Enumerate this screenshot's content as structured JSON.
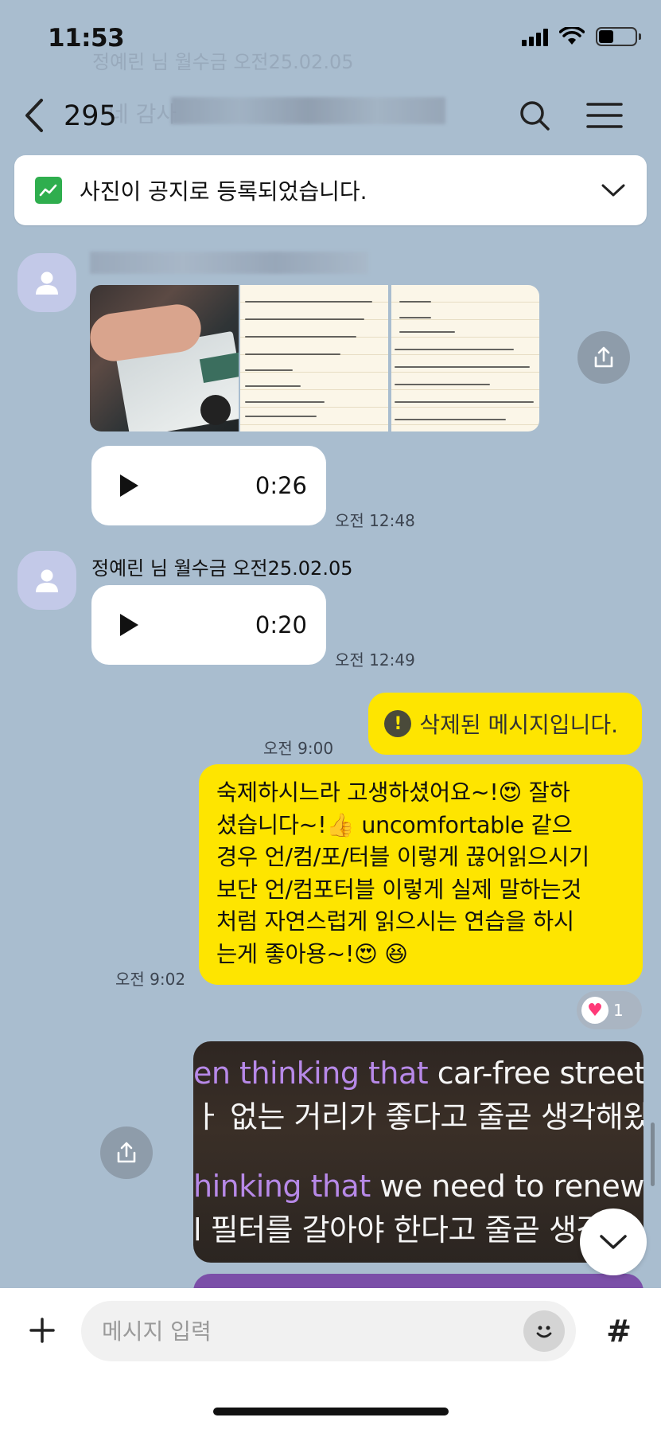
{
  "status_bar": {
    "time": "11:53",
    "battery_level": 0.4
  },
  "ghost_text": {
    "sender_line": "정예린 님 월수금 오전25.02.05",
    "message": "네 감사"
  },
  "header": {
    "member_count": "295"
  },
  "notice": {
    "text": "사진이 공지로 등록되었습니다."
  },
  "messages": {
    "voice1": {
      "duration": "0:26",
      "time": "오전 12:48"
    },
    "sender2": "정예린 님 월수금 오전25.02.05",
    "voice2": {
      "duration": "0:20",
      "time": "오전 12:49"
    },
    "deleted": {
      "text": "삭제된 메시지입니다.",
      "time": "오전 9:00"
    },
    "long": {
      "lines": [
        "숙제하시느라 고생하셨어요~!😍 잘하",
        "셨습니다~!👍 uncomfortable 같으",
        "경우 언/컴/포/터블 이렇게 끊어읽으시기",
        "보단 언/컴포터블 이렇게 실제 말하는것",
        "처럼 자연스럽게 읽으시는 연습을 하시",
        "는게 좋아용~!😍 😆"
      ],
      "time": "오전 9:02",
      "reaction_count": "1"
    },
    "video": {
      "line1_purple": "en thinking that",
      "line1_white": " car-free streets a",
      "line2": "ㅏ 없는 거리가 좋다고 줄곧 생각해왔어",
      "line3_purple": "hinking that",
      "line3_white": " we need to renew th",
      "line4": "l 필터를 갈아야 한다고 줄곧 생각"
    }
  },
  "composer": {
    "placeholder": "메시지 입력"
  },
  "icons": [
    "back-chevron-icon",
    "search-icon",
    "menu-icon",
    "chart-icon",
    "chevron-down-icon",
    "person-icon",
    "share-icon",
    "play-icon",
    "warning-icon",
    "heart-icon",
    "plus-icon",
    "emoji-icon",
    "hash-icon"
  ],
  "colors": {
    "background": "#a9bdcf",
    "my_bubble": "#fee500",
    "notice_icon": "#2fae4e",
    "heart": "#ff3a78"
  }
}
